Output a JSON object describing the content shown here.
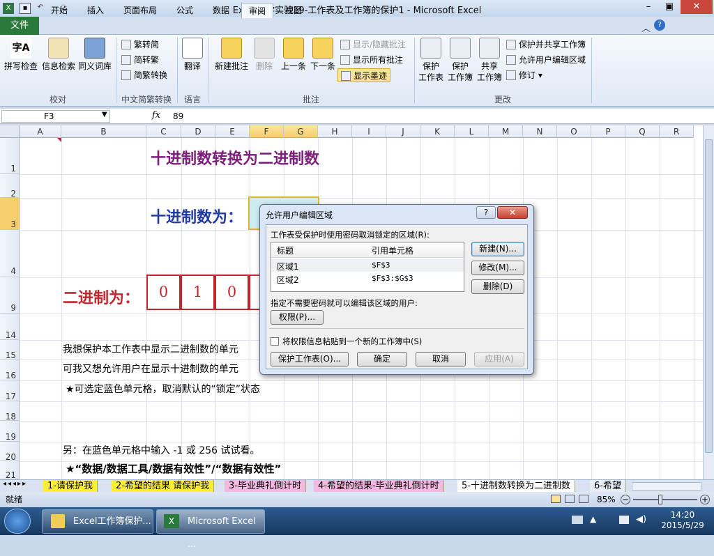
{
  "window": {
    "title": "Excel导学实验19-工作表及工作簿的保护1 - Microsoft Excel",
    "minimize": "–",
    "maximize": "▣",
    "close": "✕"
  },
  "ribbon_tabs": [
    "文件",
    "开始",
    "插入",
    "页面布局",
    "公式",
    "数据",
    "审阅",
    "视图"
  ],
  "ribbon": {
    "proofing": {
      "spell": "拼写检查",
      "research": "信息检索",
      "thesaurus": "同义词库",
      "label": "校对"
    },
    "chinese": {
      "to_simplified": "繁转简",
      "to_traditional": "简转繁",
      "convert": "简繁转换",
      "label": "中文简繁转换"
    },
    "language": {
      "translate": "翻译",
      "label": "语言"
    },
    "comments": {
      "new": "新建批注",
      "delete": "删除",
      "prev": "上一条",
      "next": "下一条",
      "show_hide": "显示/隐藏批注",
      "show_all": "显示所有批注",
      "show_ink": "显示墨迹",
      "label": "批注"
    },
    "changes": {
      "protect_sheet_1": "保护",
      "protect_sheet_2": "工作表",
      "protect_wb_1": "保护",
      "protect_wb_2": "工作簿",
      "share_1": "共享",
      "share_2": "工作簿",
      "protect_share": "保护并共享工作簿",
      "allow_edit": "允许用户编辑区域",
      "track": "修订",
      "label": "更改"
    }
  },
  "formula_bar": {
    "name_box": "F3",
    "fx": "fx",
    "value": "89"
  },
  "columns": [
    "A",
    "B",
    "C",
    "D",
    "E",
    "F",
    "G",
    "H",
    "I",
    "J",
    "K",
    "L",
    "M",
    "N",
    "O",
    "P",
    "Q",
    "R"
  ],
  "rows": [
    "1",
    "2",
    "3",
    "4",
    "9",
    "14",
    "15",
    "16",
    "17",
    "18",
    "19",
    "20",
    "21"
  ],
  "cells": {
    "title": "十进制数转换为二进制数",
    "decimal_label": "十进制数为：",
    "binary_label": "二进制为：",
    "bits": [
      "0",
      "1",
      "0"
    ],
    "line15": "我想保护本工作表中显示二进制数的单元",
    "line16": "可我又想允许用户在显示十进制数的单元",
    "line17": "★可选定蓝色单元格，取消默认的“锁定”状态",
    "line20": "另：在蓝色单元格中输入 -1 或 256 试试看。",
    "line21": "★“数据/数据工具/数据有效性”/“数据有效性”"
  },
  "sheet_tabs": [
    "1-请保护我",
    "2-希望的结果 请保护我",
    "3-毕业典礼倒计时",
    "4-希望的结果-毕业典礼倒计时",
    "5-十进制数转换为二进制数",
    "6-希望"
  ],
  "status": {
    "ready": "就绪",
    "zoom": "85%"
  },
  "taskbar": {
    "item1": "Excel工作簿保护...",
    "item2": "Microsoft Excel ...",
    "time": "14:20",
    "date": "2015/5/29"
  },
  "dialog": {
    "title": "允许用户编辑区域",
    "help": "?",
    "close": "✕",
    "ranges_label": "工作表受保护时使用密码取消锁定的区域(R):",
    "col_title": "标题",
    "col_ref": "引用单元格",
    "rows": [
      {
        "title": "区域1",
        "ref": "$F$3"
      },
      {
        "title": "区域2",
        "ref": "$F$3:$G$3"
      }
    ],
    "btn_new": "新建(N)...",
    "btn_modify": "修改(M)...",
    "btn_delete": "删除(D)",
    "users_label": "指定不需要密码就可以编辑该区域的用户:",
    "btn_permissions": "权限(P)...",
    "paste_checkbox": "将权限信息粘贴到一个新的工作簿中(S)",
    "btn_protect": "保护工作表(O)...",
    "btn_ok": "确定",
    "btn_cancel": "取消",
    "btn_apply": "应用(A)"
  }
}
